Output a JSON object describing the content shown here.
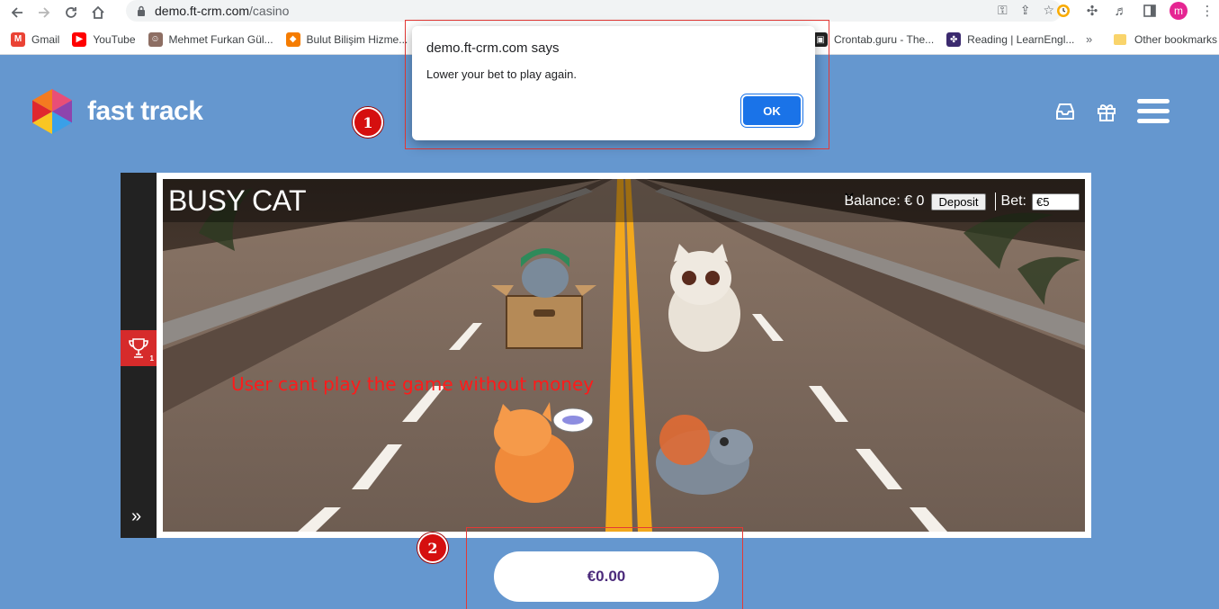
{
  "browser": {
    "url_host": "demo.ft-crm.com",
    "url_path": "/casino",
    "bookmarks": [
      {
        "label": "Gmail",
        "color": "#ea4335",
        "glyph": "M"
      },
      {
        "label": "YouTube",
        "color": "#ff0000",
        "glyph": "▶"
      },
      {
        "label": "Mehmet Furkan Gül...",
        "color": "#8d6e63",
        "glyph": "☺"
      },
      {
        "label": "Bulut Bilişim Hizme...",
        "color": "#f57c00",
        "glyph": "◆"
      }
    ],
    "bookmarks_right": [
      {
        "label": "Crontab.guru - The...",
        "color": "#222222",
        "glyph": "▣"
      },
      {
        "label": "Reading | LearnEngl...",
        "color": "#3b2a6e",
        "glyph": "✤"
      }
    ],
    "more_bookmarks": "»",
    "other_bookmarks": "Other bookmarks",
    "profile_initial": "m"
  },
  "site": {
    "brand": "fast track"
  },
  "game": {
    "title": "BUSY CAT",
    "balance_label": "Balance: € 0",
    "deposit_label": "Deposit",
    "bet_label": "Bet:",
    "bet_value": "€5",
    "trophy_count": "1",
    "annotation": "User cant play the game without money"
  },
  "bottom": {
    "amount": "€0.00"
  },
  "annotations": {
    "badge1": "1",
    "badge2": "2",
    "accent": "#e53935"
  },
  "dialog": {
    "title": "demo.ft-crm.com says",
    "message": "Lower your bet to play again.",
    "ok_label": "OK"
  }
}
